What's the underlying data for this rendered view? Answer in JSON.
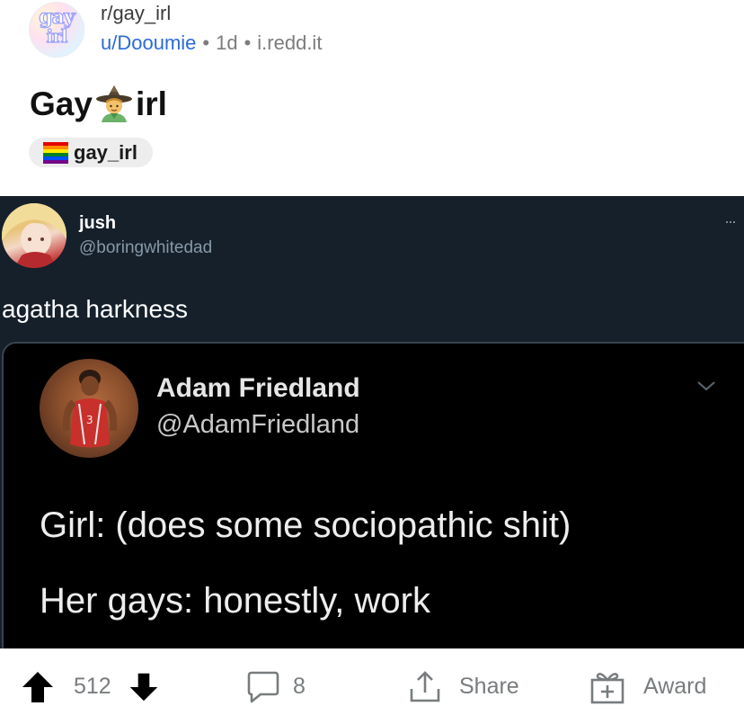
{
  "post": {
    "subreddit": "r/gay_irl",
    "author": "u/Dooumie",
    "age": "1d",
    "domain": "i.redd.it",
    "title_before": "Gay",
    "title_after": "irl",
    "flair": "gay_irl",
    "subreddit_avatar_text_line1": "gay",
    "subreddit_avatar_text_line2": "irl"
  },
  "tweet": {
    "name": "jush",
    "handle": "@boringwhitedad",
    "text": "agatha harkness",
    "more": "···",
    "quoted": {
      "name": "Adam Friedland",
      "handle": "@AdamFriedland",
      "line1": "Girl: (does some sociopathic shit)",
      "line2": "Her gays: honestly, work"
    }
  },
  "actions": {
    "score": "512",
    "comments": "8",
    "share_label": "Share",
    "award_label": "Award"
  },
  "icons": {
    "upvote": "arrow-up-icon",
    "downvote": "arrow-down-icon",
    "comment": "speech-bubble-icon",
    "share": "share-upload-icon",
    "award": "gift-icon",
    "flair": "rainbow-flag-icon",
    "title_emoji": "witch-emoji",
    "more": "more-dots-icon",
    "chevron": "chevron-down-icon"
  },
  "colors": {
    "author_link": "#2c6bd6",
    "tweet_background": "#15202b",
    "quote_background": "#000000",
    "muted_text": "#787c7e"
  }
}
